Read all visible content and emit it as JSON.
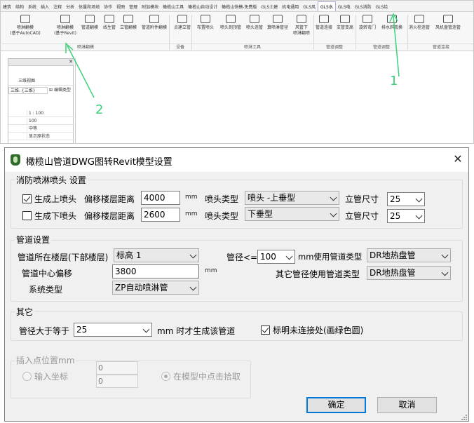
{
  "revit": {
    "menu_tabs": [
      "建筑",
      "结构",
      "系统",
      "插入",
      "注释",
      "分析",
      "体量和场地",
      "协作",
      "视图",
      "管理",
      "附加模块",
      "橄榄山工具",
      "橄榄山自动设计",
      "橄榄山快模-免费版",
      "GLS土建",
      "机电通用",
      "GLS风",
      "GLS水",
      "GLS电",
      "GLS消防",
      "GLS给"
    ],
    "active_tab": "GLS水",
    "ribbon_buttons": [
      "喷淋翻模\n(基于AutoCAD)",
      "喷淋翻模\n(基于Revit)",
      "管道翻模",
      "线生管",
      "立管翻模",
      "管道附件翻模",
      "点建立管",
      "布置喷头",
      "喷头到顶管",
      "喷头连管",
      "算喷淋管径",
      "风管下\n喷淋翻喷",
      "管道连接",
      "支管变高",
      "旋转弯门",
      "排水斜弯换",
      "消火栓连管",
      "风机盘管连管"
    ],
    "ribbon_groups": [
      "喷淋翻模",
      "设备",
      "喷淋工具",
      "管道调整",
      "管道调整",
      "管道连接"
    ],
    "props_view_type": "三维视图",
    "props_dropdown": "三维: {三维}",
    "props_edit_type": "编辑类型",
    "props_rows": [
      {
        "k": "",
        "v": "1 : 100"
      },
      {
        "k": "",
        "v": "100"
      },
      {
        "k": "",
        "v": "中等"
      },
      {
        "k": "",
        "v": "显示原状态"
      }
    ],
    "annotation_1": "1",
    "annotation_2": "2"
  },
  "dialog": {
    "title": "橄榄山管道DWG图转Revit模型设置",
    "close_icon": "close-icon",
    "sprinkler": {
      "legend": "消防喷淋喷头 设置",
      "upper": {
        "label": "生成上喷头",
        "checked": true,
        "offset_label": "偏移楼层距离",
        "offset_value": "4000",
        "unit": "mm",
        "type_label": "喷头类型",
        "type_value": "喷头 -上垂型",
        "riser_label": "立管尺寸",
        "riser_value": "25"
      },
      "lower": {
        "label": "生成下喷头",
        "checked": false,
        "offset_label": "偏移楼层距离",
        "offset_value": "2600",
        "unit": "mm",
        "type_label": "喷头类型",
        "type_value": "下垂型",
        "riser_label": "立管尺寸",
        "riser_value": "25"
      }
    },
    "pipe": {
      "legend": "管道设置",
      "level_label": "管道所在楼层(下部楼层)",
      "level_value": "标高 1",
      "center_offset_label": "管道中心偏移",
      "center_offset_value": "3800",
      "unit": "mm",
      "system_label": "系统类型",
      "system_value": "ZP自动喷淋管",
      "diameter_label": "管径<=",
      "diameter_value": "100",
      "diameter_suffix": "mm使用管道类型",
      "type_value": "DR地热盘管",
      "other_label": "其它管径使用管道类型",
      "other_value": "DR地热盘管"
    },
    "other": {
      "legend": "其它",
      "min_label": "管径大于等于",
      "min_value": "25",
      "min_suffix": "mm 时才生成该管道",
      "mark_label": "标明未连接处(画绿色圆)",
      "mark_checked": true
    },
    "insert": {
      "legend": "插入点位置mm",
      "coord_label": "输入坐标",
      "x_value": "0",
      "y_value": "0",
      "pick_label": "在模型中点击拾取"
    },
    "ok_label": "确定",
    "cancel_label": "取消"
  }
}
